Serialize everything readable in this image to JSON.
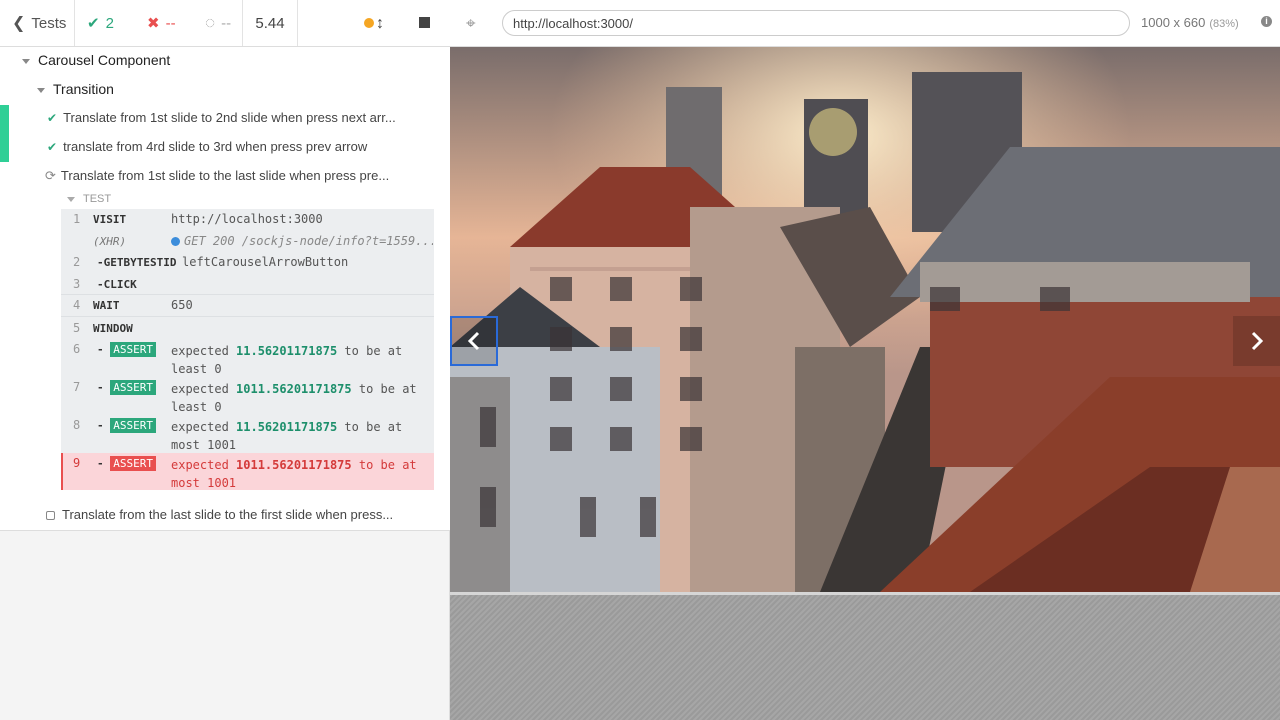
{
  "topbar": {
    "tests_label": "Tests",
    "passed": "2",
    "failed": "--",
    "pending": "--",
    "duration": "5.44"
  },
  "tree": {
    "suite": "Carousel Component",
    "subsuite": "Transition",
    "tests": [
      "Translate from 1st slide to 2nd slide when press next arr...",
      "translate from 4rd slide to 3rd when press prev arrow",
      "Translate from 1st slide to the last slide when press pre...",
      "Translate from the last slide to the first slide when press..."
    ],
    "test_section_label": "TEST"
  },
  "commands": {
    "c1": {
      "num": "1",
      "name": "VISIT",
      "msg": "http://localhost:3000"
    },
    "xhr": {
      "name": "(XHR)",
      "msg": "GET 200 /sockjs-node/info?t=1559..."
    },
    "c2": {
      "num": "2",
      "name": "-GETBYTESTID",
      "msg": "leftCarouselArrowButton"
    },
    "c3": {
      "num": "3",
      "name": "-CLICK"
    },
    "c4": {
      "num": "4",
      "name": "WAIT",
      "msg": "650"
    },
    "c5": {
      "num": "5",
      "name": "WINDOW"
    },
    "c6": {
      "num": "6",
      "dash": "-",
      "badge": "ASSERT",
      "pre": "expected",
      "val": "11.56201171875",
      "post": "to be at",
      "post2": "least 0"
    },
    "c7": {
      "num": "7",
      "dash": "-",
      "badge": "ASSERT",
      "pre": "expected",
      "val": "1011.56201171875",
      "post": "to be at",
      "post2": "least 0"
    },
    "c8": {
      "num": "8",
      "dash": "-",
      "badge": "ASSERT",
      "pre": "expected",
      "val": "11.56201171875",
      "post": "to be at",
      "post2": "most 1001"
    },
    "c9": {
      "num": "9",
      "dash": "-",
      "badge": "ASSERT",
      "pre": "expected",
      "val": "1011.56201171875",
      "post": "to be at",
      "post2": "most 1001"
    }
  },
  "aut": {
    "url": "http://localhost:3000/",
    "viewport": "1000 x 660",
    "scale": "(83%)"
  },
  "icons": {
    "back": "chevron-left-icon",
    "pass": "check-icon",
    "fail": "x-icon",
    "pending": "circle-notch-icon",
    "running": "refresh-icon",
    "selector": "crosshair-icon",
    "info": "info-icon"
  },
  "colors": {
    "pass": "#2ca77c",
    "fail": "#e94f4f",
    "running_dot": "#f5a623",
    "selected_border": "#2a6ad8"
  }
}
